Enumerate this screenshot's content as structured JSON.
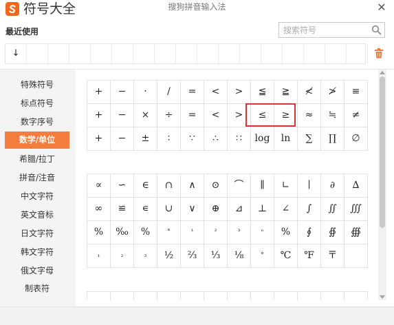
{
  "header": {
    "app_title": "符号大全",
    "window_title": "搜狗拼音输入法",
    "close_label": "✕"
  },
  "recent": {
    "title": "最近使用",
    "cells": [
      "↓",
      "",
      "",
      "",
      "",
      "",
      "",
      "",
      "",
      "",
      "",
      "",
      "",
      "",
      "",
      "",
      ""
    ]
  },
  "search": {
    "placeholder": "搜索符号",
    "value": ""
  },
  "sidebar": {
    "items": [
      {
        "label": "特殊符号",
        "active": false
      },
      {
        "label": "标点符号",
        "active": false
      },
      {
        "label": "数字序号",
        "active": false
      },
      {
        "label": "数学/单位",
        "active": true
      },
      {
        "label": "希腊/拉丁",
        "active": false
      },
      {
        "label": "拼音/注音",
        "active": false
      },
      {
        "label": "中文字符",
        "active": false
      },
      {
        "label": "英文音标",
        "active": false
      },
      {
        "label": "日文字符",
        "active": false
      },
      {
        "label": "韩文字符",
        "active": false
      },
      {
        "label": "俄文字母",
        "active": false
      },
      {
        "label": "制表符",
        "active": false
      }
    ]
  },
  "section1": {
    "rows": [
      [
        "+",
        "−",
        "·",
        "/",
        "=",
        "<",
        ">",
        "≦",
        "≧",
        "≮",
        "≯",
        "≡"
      ],
      [
        "+",
        "−",
        "×",
        "÷",
        "=",
        "<",
        ">",
        "≤",
        "≥",
        "≈",
        "≒",
        "≠"
      ],
      [
        "+",
        "−",
        "±",
        "∶",
        "∵",
        "∴",
        "∷",
        "log",
        "ln",
        "∑",
        "∏",
        "∅"
      ]
    ]
  },
  "section2": {
    "rows": [
      [
        "∝",
        "∽",
        "∈",
        "∩",
        "∧",
        "⊙",
        "⌒",
        "∥",
        "∟",
        "∣",
        "∂",
        "∆"
      ],
      [
        "∞",
        "≌",
        "∊",
        "∪",
        "∨",
        "⊕",
        "⊿",
        "⊥",
        "∠",
        "∫",
        "∬",
        "∭"
      ],
      [
        "%",
        "‰",
        "%",
        "°",
        "¹",
        "²",
        "³",
        "ⁿ",
        "%",
        "∮",
        "∯",
        "∰"
      ],
      [
        "₁",
        "₂",
        "₃",
        "½",
        "⅔",
        "⅓",
        "⅛",
        "°",
        "℃",
        "℉",
        "〒",
        ""
      ]
    ]
  },
  "section3": {
    "rows": [
      [
        "",
        "",
        "",
        "",
        "",
        "",
        "",
        "",
        "",
        "",
        "",
        ""
      ]
    ]
  },
  "colors": {
    "accent": "#f47c3c",
    "highlight": "#e03030",
    "sidebar_bg": "#f4f4f4"
  }
}
